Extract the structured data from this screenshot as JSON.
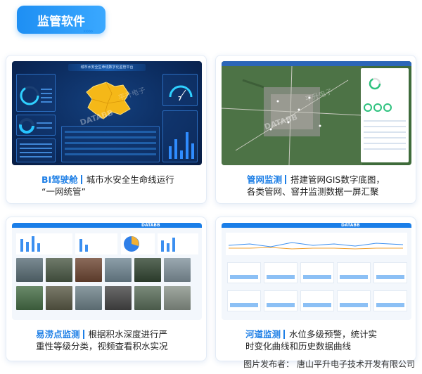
{
  "header": {
    "title": "监管软件"
  },
  "cards": [
    {
      "title": "BI驾驶舱",
      "desc_line1": "城市水安全生命线运行",
      "desc_line2": "“一网统管”"
    },
    {
      "title": "管网监测",
      "desc_line1": "搭建管网GIS数字底图，",
      "desc_line2": "各类管网、窨井监测数据一屏汇聚"
    },
    {
      "title": "易涝点监测",
      "desc_line1": "根据积水深度进行严",
      "desc_line2": "重性等级分类，视频查看积水实况"
    },
    {
      "title": "河道监测",
      "desc_line1": "水位多级预警，统计实",
      "desc_line2": "时变化曲线和历史数据曲线"
    }
  ],
  "screens": {
    "dashboard_title": "城市水安全生命线数字化监管平台",
    "watermark": "DATABB",
    "brand_text": "平升电子",
    "dashboard_big_number": "7"
  },
  "footer": {
    "credit": "图片发布者： 唐山平升电子技术开发有限公司"
  },
  "colors": {
    "accent": "#1e7fe6",
    "dashboard_bg": "#0b2a5c",
    "map_green": "#3e6b3a"
  }
}
